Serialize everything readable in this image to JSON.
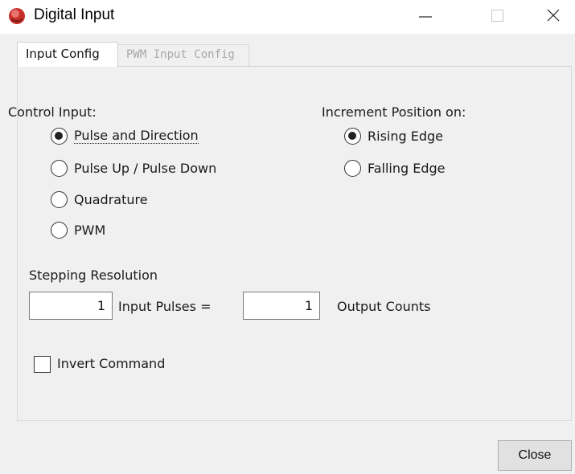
{
  "window": {
    "title": "Digital Input",
    "icon": "app-logo-icon",
    "controls": [
      "minimize-icon",
      "maximize-icon",
      "close-icon"
    ]
  },
  "tabs": [
    {
      "label": "Input Config",
      "active": true
    },
    {
      "label": "PWM Input Config",
      "active": false
    }
  ],
  "control_input": {
    "heading": "Control Input:",
    "options": [
      {
        "label": "Pulse and Direction",
        "selected": true
      },
      {
        "label": "Pulse Up / Pulse Down",
        "selected": false
      },
      {
        "label": "Quadrature",
        "selected": false
      },
      {
        "label": "PWM",
        "selected": false
      }
    ]
  },
  "increment_position": {
    "heading": "Increment Position on:",
    "options": [
      {
        "label": "Rising Edge",
        "selected": true
      },
      {
        "label": "Falling Edge",
        "selected": false
      }
    ]
  },
  "stepping": {
    "heading": "Stepping Resolution",
    "input_pulses_value": "1",
    "input_pulses_label": "Input Pulses =",
    "output_counts_value": "1",
    "output_counts_label": "Output Counts"
  },
  "invert_command": {
    "label": "Invert Command",
    "checked": false
  },
  "footer": {
    "close_label": "Close"
  }
}
